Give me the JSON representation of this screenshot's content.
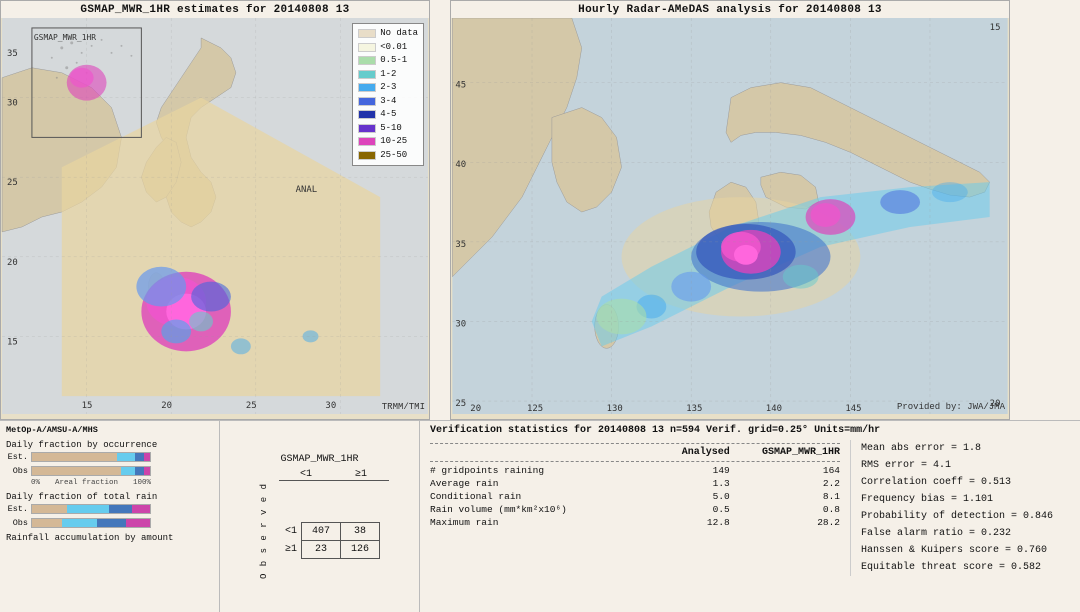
{
  "left_map": {
    "title": "GSMAP_MWR_1HR estimates for 20140808 13",
    "bottom_label": "TRMM/TMI",
    "top_left_label": "GSMAP_MWR_1HR",
    "sub_label": "MetOp-A/AMSU-A/MHS"
  },
  "right_map": {
    "title": "Hourly Radar-AMeDAS analysis for 20140808 13",
    "bottom_label": "Provided by: JWA/JMA",
    "lat_labels": [
      "45",
      "40",
      "35",
      "30",
      "25",
      "20"
    ],
    "lon_labels": [
      "120",
      "125",
      "130",
      "135",
      "140",
      "145",
      "15"
    ]
  },
  "legend": {
    "title": "",
    "items": [
      {
        "label": "No data",
        "color": "#e8e0c8"
      },
      {
        "label": "<0.01",
        "color": "#f5f5e0"
      },
      {
        "label": "0.5-1",
        "color": "#aaddaa"
      },
      {
        "label": "1-2",
        "color": "#66cccc"
      },
      {
        "label": "2-3",
        "color": "#44aaee"
      },
      {
        "label": "3-4",
        "color": "#4466dd"
      },
      {
        "label": "4-5",
        "color": "#2233aa"
      },
      {
        "label": "5-10",
        "color": "#6633cc"
      },
      {
        "label": "10-25",
        "color": "#dd44bb"
      },
      {
        "label": "25-50",
        "color": "#886600"
      }
    ]
  },
  "contingency_table": {
    "title": "GSMAP_MWR_1HR",
    "col_headers": [
      "<1",
      "≥1"
    ],
    "row_headers": [
      "<1",
      "≥1"
    ],
    "values": [
      [
        "407",
        "38"
      ],
      [
        "23",
        "126"
      ]
    ],
    "obs_label": "O\nb\ns\ne\nr\nv\ne\nd"
  },
  "bar_charts": {
    "title1": "Daily fraction by occurrence",
    "title2": "Daily fraction of total rain",
    "title3": "Rainfall accumulation by amount",
    "est_label": "Est.",
    "obs_label": "Obs",
    "axis_start": "0%",
    "axis_end": "100%",
    "axis_label": "Areal fraction"
  },
  "verification": {
    "title": "Verification statistics for 20140808 13  n=594  Verif. grid=0.25°  Units=mm/hr",
    "columns": [
      "Analysed",
      "GSMAP_MWR_1HR"
    ],
    "rows": [
      {
        "label": "# gridpoints raining",
        "analysed": "149",
        "gsmap": "164"
      },
      {
        "label": "Average rain",
        "analysed": "1.3",
        "gsmap": "2.2"
      },
      {
        "label": "Conditional rain",
        "analysed": "5.0",
        "gsmap": "8.1"
      },
      {
        "label": "Rain volume (mm*km²x10⁶)",
        "analysed": "0.5",
        "gsmap": "0.8"
      },
      {
        "label": "Maximum rain",
        "analysed": "12.8",
        "gsmap": "28.2"
      }
    ],
    "right_stats": [
      "Mean abs error = 1.8",
      "RMS error = 4.1",
      "Correlation coeff = 0.513",
      "Frequency bias = 1.101",
      "Probability of detection = 0.846",
      "False alarm ratio = 0.232",
      "Hanssen & Kuipers score = 0.760",
      "Equitable threat score = 0.582"
    ]
  }
}
